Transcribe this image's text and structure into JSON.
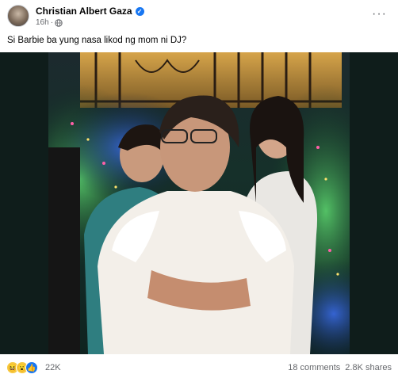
{
  "post": {
    "author": "Christian Albert Gaza",
    "time": "16h",
    "audience_icon": "globe-icon",
    "caption": "Si Barbie ba yung nasa likod ng mom ni DJ?"
  },
  "footer": {
    "reaction_icons": [
      "haha-icon",
      "wow-icon",
      "like-icon"
    ],
    "reaction_count": "22K",
    "comments": "18 comments",
    "shares": "2.8K shares"
  },
  "colors": {
    "accent": "#1877f2",
    "muted_text": "#65676b",
    "media_bg": "#0f1d1b"
  }
}
